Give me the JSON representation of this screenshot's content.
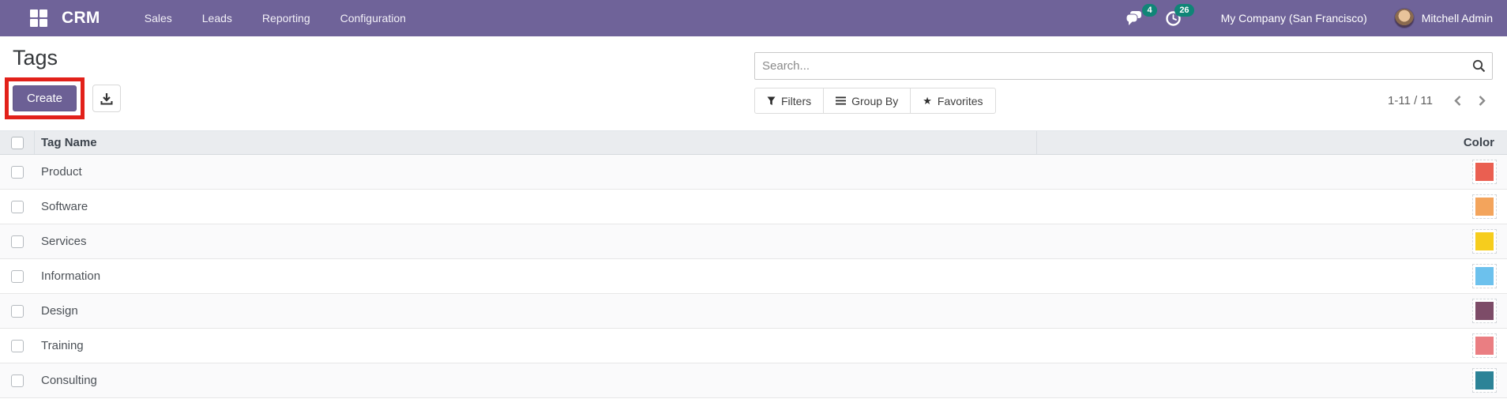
{
  "nav": {
    "brand": "CRM",
    "menus": [
      {
        "label": "Sales"
      },
      {
        "label": "Leads"
      },
      {
        "label": "Reporting"
      },
      {
        "label": "Configuration"
      }
    ],
    "messages_badge": "4",
    "activities_badge": "26",
    "company": "My Company (San Francisco)",
    "user": "Mitchell Admin"
  },
  "page": {
    "title": "Tags"
  },
  "toolbar": {
    "create_label": "Create"
  },
  "search": {
    "placeholder": "Search..."
  },
  "filter_bar": {
    "filters_label": "Filters",
    "group_by_label": "Group By",
    "favorites_label": "Favorites",
    "star_glyph": "★"
  },
  "pager": {
    "range": "1-11 / 11"
  },
  "table": {
    "columns": {
      "select_all": "",
      "tag_name": "Tag Name",
      "color": "Color"
    },
    "rows": [
      {
        "name": "Product",
        "color": "#ea5f51"
      },
      {
        "name": "Software",
        "color": "#f3a45c"
      },
      {
        "name": "Services",
        "color": "#f6cd1d"
      },
      {
        "name": "Information",
        "color": "#6cc1ed"
      },
      {
        "name": "Design",
        "color": "#7d4c68"
      },
      {
        "name": "Training",
        "color": "#ea7e82"
      },
      {
        "name": "Consulting",
        "color": "#2c8397"
      }
    ]
  },
  "colors": {
    "accent_purple": "#6f6399",
    "create_button_purple": "#6c6095",
    "badge_teal": "#108577",
    "annotation_red": "#e2211a",
    "header_bg": "#eaecef"
  }
}
